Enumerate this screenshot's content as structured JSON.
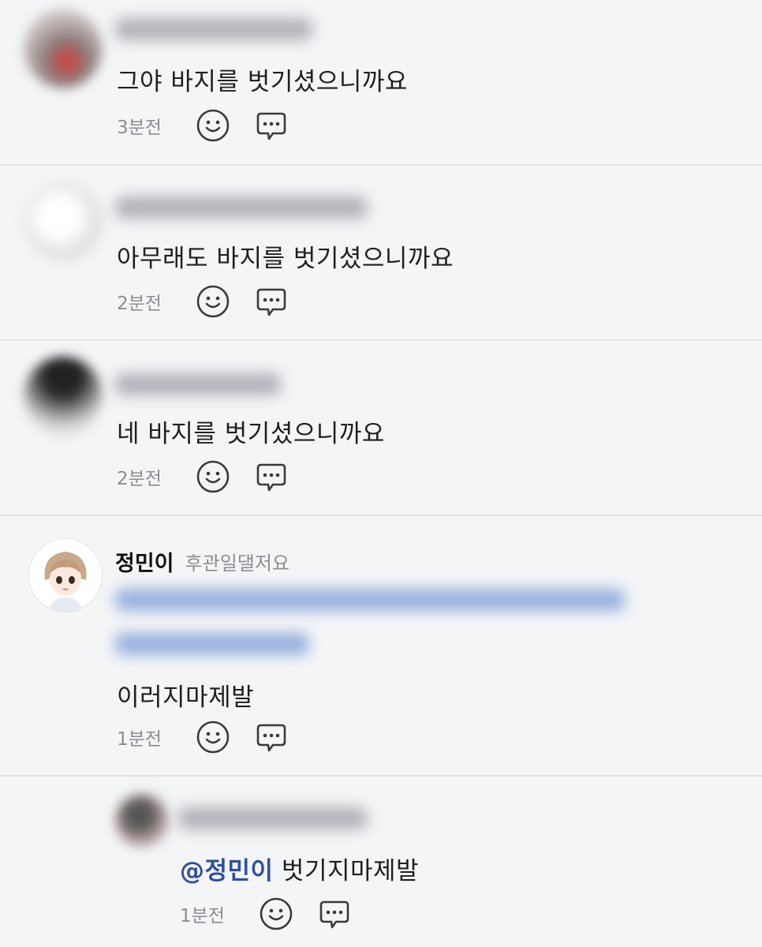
{
  "comments": [
    {
      "text": "그야 바지를 벗기셨으니까요",
      "time": "3분전"
    },
    {
      "text": "아무래도 바지를 벗기셨으니까요",
      "time": "2분전"
    },
    {
      "text": "네 바지를 벗기셨으니까요",
      "time": "2분전"
    },
    {
      "author": "정민이",
      "author_tag": "후관일댈저요",
      "text": "이러지마제발",
      "time": "1분전"
    },
    {
      "mention": "@정민이",
      "text": "벗기지마제발",
      "time": "1분전"
    }
  ],
  "icons": {
    "react": "smile-icon",
    "reply": "speech-bubble-icon"
  },
  "colors": {
    "background": "#f4f5f7",
    "mention": "#2f4fa0",
    "meta": "#8b8d93"
  }
}
